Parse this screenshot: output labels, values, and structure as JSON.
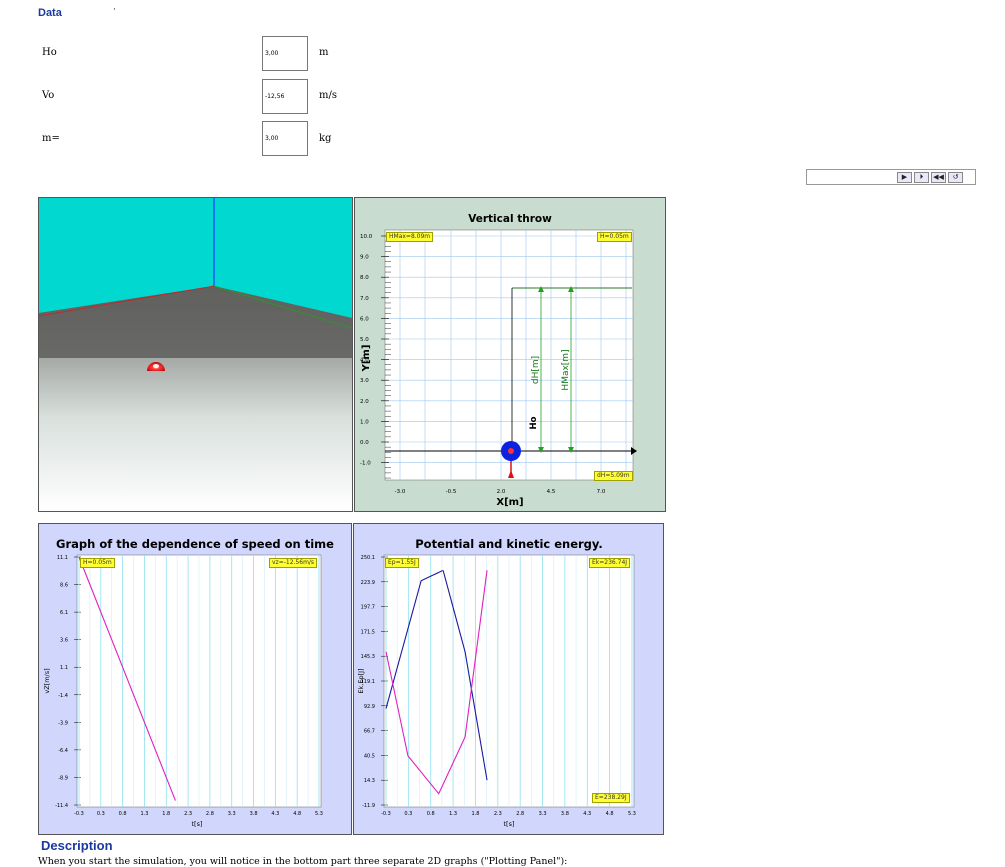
{
  "data_section": {
    "title": "Data",
    "dot": "·",
    "fields": [
      {
        "label": "Ho",
        "value": "3,00",
        "unit": "m"
      },
      {
        "label": "Vo",
        "value": "-12,56",
        "unit": "m/s"
      },
      {
        "label": "m=",
        "value": "3,00",
        "unit": "kg"
      }
    ]
  },
  "controls": {
    "icons": [
      "play-icon",
      "step-icon",
      "rewind-icon",
      "reset-icon"
    ],
    "glyphs": [
      "▶",
      "⏵",
      "◀◀",
      "↺"
    ]
  },
  "scene3d": {
    "colors": {
      "wall": "#00d8d0",
      "floor_top": "#5e5e5c",
      "floor_bottom": "#ffffff",
      "ball": "#e01010"
    }
  },
  "vertical_throw": {
    "title": "Vertical throw",
    "tag_hmax": "HMax=8.09m",
    "tag_h": "H=0.05m",
    "tag_dh": "dH=5.09m",
    "ylabel": "Y[m]",
    "xlabel": "X[m]",
    "y_ticks": [
      "10.0",
      "9.0",
      "8.0",
      "7.0",
      "6.0",
      "5.0",
      "4.0",
      "3.0",
      "2.0",
      "1.0",
      "0.0",
      "-1.0"
    ],
    "x_ticks": [
      "-3.0",
      "-0.5",
      "2.0",
      "4.5",
      "7.0"
    ],
    "label_ho": "Ho",
    "label_dh": "dH[m]",
    "label_hmax": "HMax[m]"
  },
  "speed_graph": {
    "title": "Graph of the dependence of speed on time",
    "tag_h": "H=0.05m",
    "tag_vz": "vz=-12.56m/s",
    "ylabel": "vZ[m/s]",
    "xlabel": "t[s]",
    "y_ticks": [
      "11.1",
      "8.6",
      "6.1",
      "3.6",
      "1.1",
      "-1.4",
      "-3.9",
      "-6.4",
      "-8.9",
      "-11.4"
    ],
    "x_ticks": [
      "-0.3",
      "0.3",
      "0.8",
      "1.3",
      "1.8",
      "2.3",
      "2.8",
      "3.3",
      "3.8",
      "4.3",
      "4.8",
      "5.3"
    ]
  },
  "energy_graph": {
    "title": "Potential and kinetic energy.",
    "tag_ep": "Ep=1.55J",
    "tag_ek": "Ek=236.74J",
    "tag_e": "E=238.29J",
    "ylabel": "Ek,Ep[J]",
    "xlabel": "t[s]",
    "y_ticks": [
      "250.1",
      "223.9",
      "197.7",
      "171.5",
      "145.3",
      "119.1",
      "92.9",
      "66.7",
      "40.5",
      "14.3",
      "-11.9"
    ],
    "x_ticks": [
      "-0.3",
      "0.3",
      "0.8",
      "1.3",
      "1.8",
      "2.3",
      "2.8",
      "3.3",
      "3.8",
      "4.3",
      "4.8",
      "5.3"
    ]
  },
  "chart_data": [
    {
      "type": "line",
      "title": "Graph of the dependence of speed on time",
      "xlabel": "t[s]",
      "ylabel": "vZ[m/s]",
      "xlim": [
        -0.3,
        5.3
      ],
      "ylim": [
        -11.4,
        11.1
      ],
      "series": [
        {
          "values_x": [
            -0.3,
            1.95
          ],
          "values_y": [
            11.1,
            -11.0
          ]
        }
      ]
    },
    {
      "type": "line",
      "title": "Potential and kinetic energy.",
      "xlabel": "t[s]",
      "ylabel": "Ek,Ep[J]",
      "xlim": [
        -0.3,
        5.3
      ],
      "ylim": [
        -11.9,
        250.1
      ],
      "series": [
        {
          "values_x": [
            -0.3,
            0.5,
            1.0,
            1.5,
            2.0
          ],
          "values_y": [
            90,
            225,
            236,
            150,
            14.3
          ]
        },
        {
          "values_x": [
            -0.3,
            0.2,
            0.9,
            1.5,
            2.0
          ],
          "values_y": [
            150,
            40,
            0,
            60,
            236
          ]
        }
      ]
    }
  ],
  "description": {
    "title": "Description",
    "text": "When you start the simulation, you will notice in the bottom part three separate 2D graphs (\"Plotting Panel\"):"
  }
}
